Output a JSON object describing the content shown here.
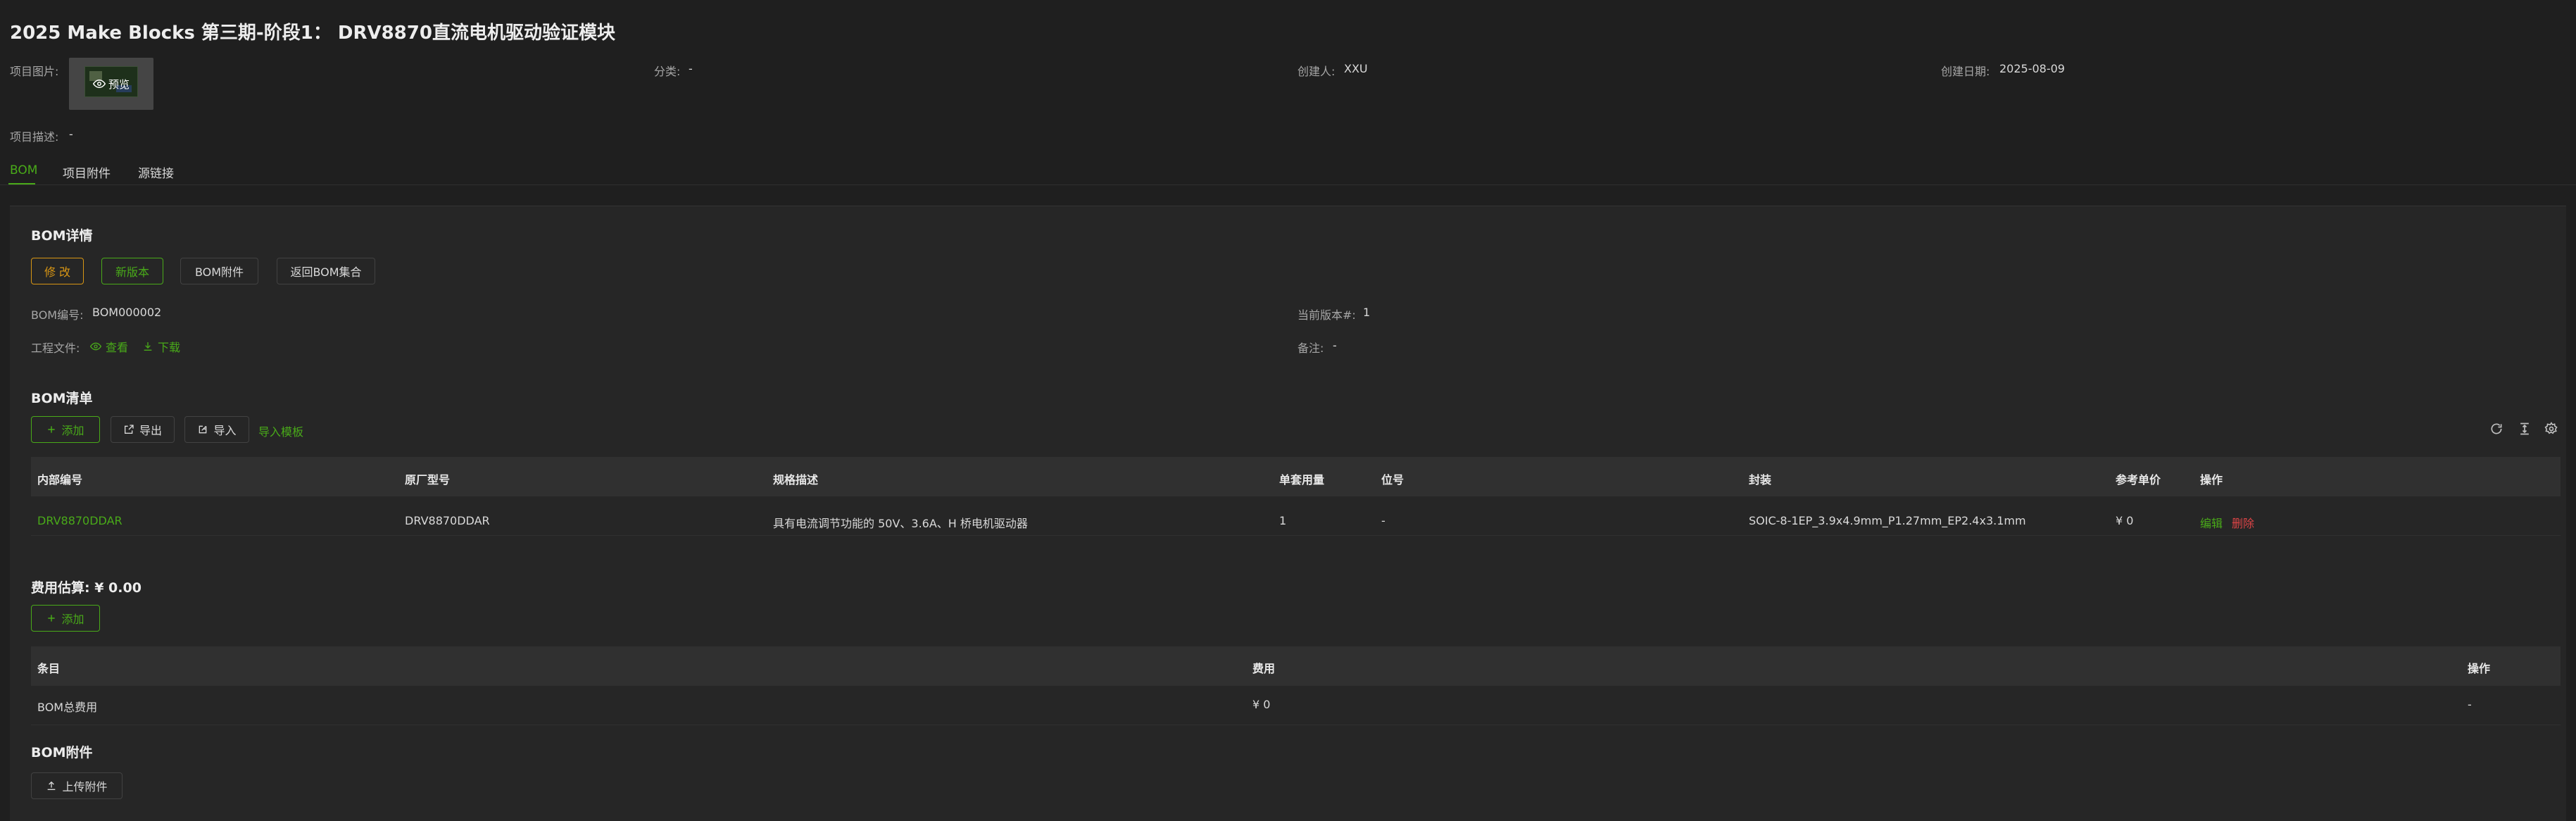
{
  "project": {
    "title": "2025 Make Blocks 第三期-阶段1：  DRV8870直流电机驱动验证模块",
    "image_label": "项目图片:",
    "preview_label": "预览",
    "category_label": "分类:",
    "category_value": "-",
    "creator_label": "创建人:",
    "creator_value": "XXU",
    "created_date_label": "创建日期:",
    "created_date_value": "2025-08-09",
    "description_label": "项目描述:",
    "description_value": "-"
  },
  "tabs": [
    {
      "label": "BOM",
      "active": true
    },
    {
      "label": "项目附件",
      "active": false
    },
    {
      "label": "源链接",
      "active": false
    }
  ],
  "bom_detail": {
    "title": "BOM详情",
    "buttons": {
      "edit": "修 改",
      "new_version": "新版本",
      "attachments": "BOM附件",
      "back": "返回BOM集合"
    },
    "bom_no_label": "BOM编号:",
    "bom_no_value": "BOM000002",
    "version_label": "当前版本#:",
    "version_value": "1",
    "eng_file_label": "工程文件:",
    "view_label": "查看",
    "download_label": "下载",
    "remark_label": "备注:",
    "remark_value": "-"
  },
  "bom_list": {
    "title": "BOM清单",
    "buttons": {
      "add": "添加",
      "export": "导出",
      "import": "导入",
      "template": "导入模板"
    },
    "columns": [
      "内部编号",
      "原厂型号",
      "规格描述",
      "单套用量",
      "位号",
      "封装",
      "参考单价",
      "操作"
    ],
    "rows": [
      {
        "internal_no": "DRV8870DDAR",
        "mfr_part": "DRV8870DDAR",
        "spec": "具有电流调节功能的 50V、3.6A、H 桥电机驱动器",
        "qty": "1",
        "designator": "-",
        "package": "SOIC-8-1EP_3.9x4.9mm_P1.27mm_EP2.4x3.1mm",
        "unit_price": "¥ 0",
        "edit": "编辑",
        "delete": "删除"
      }
    ]
  },
  "cost": {
    "title": "费用估算: ¥ 0.00",
    "add": "添加",
    "columns": [
      "条目",
      "费用",
      "操作"
    ],
    "rows": [
      {
        "item": "BOM总费用",
        "amount": "¥ 0",
        "action": "-"
      }
    ]
  },
  "bom_attach": {
    "title": "BOM附件",
    "upload": "上传附件"
  },
  "colors": {
    "background": "#1f1f1f",
    "card": "#262626",
    "accent_green": "#49aa19",
    "warning_orange": "#d89614",
    "danger_red": "#dc4446"
  }
}
